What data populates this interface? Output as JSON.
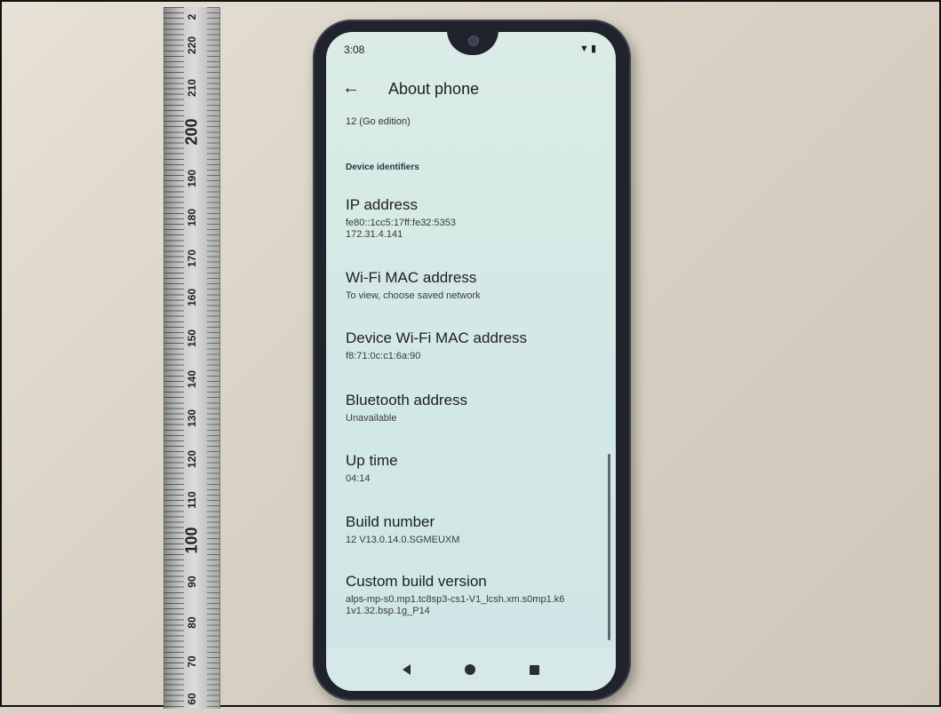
{
  "ruler": {
    "labels": [
      {
        "text": "220",
        "big": false
      },
      {
        "text": "210",
        "big": false
      },
      {
        "text": "200",
        "big": true
      },
      {
        "text": "190",
        "big": false
      },
      {
        "text": "180",
        "big": false
      },
      {
        "text": "170",
        "big": false
      },
      {
        "text": "160",
        "big": false
      },
      {
        "text": "150",
        "big": false
      },
      {
        "text": "140",
        "big": false
      },
      {
        "text": "130",
        "big": false
      },
      {
        "text": "120",
        "big": false
      },
      {
        "text": "110",
        "big": false
      },
      {
        "text": "100",
        "big": true
      },
      {
        "text": "90",
        "big": false
      },
      {
        "text": "80",
        "big": false
      },
      {
        "text": "70",
        "big": false
      },
      {
        "text": "60",
        "big": false
      }
    ],
    "top_partial": "2"
  },
  "status": {
    "time": "3:08",
    "icons": [
      "wifi-icon",
      "battery-icon"
    ]
  },
  "header": {
    "title": "About phone",
    "back_icon": "arrow-left-icon"
  },
  "android_version": {
    "value": "12 (Go edition)"
  },
  "section": {
    "title": "Device identifiers"
  },
  "items": [
    {
      "title": "IP address",
      "summary": "fe80::1cc5:17ff:fe32:5353\n172.31.4.141"
    },
    {
      "title": "Wi-Fi MAC address",
      "summary": "To view, choose saved network"
    },
    {
      "title": "Device Wi-Fi MAC address",
      "summary": "f8:71:0c:c1:6a:90"
    },
    {
      "title": "Bluetooth address",
      "summary": "Unavailable"
    },
    {
      "title": "Up time",
      "summary": "04:14"
    },
    {
      "title": "Build number",
      "summary": "12 V13.0.14.0.SGMEUXM"
    },
    {
      "title": "Custom build version",
      "summary": "alps-mp-s0.mp1.tc8sp3-cs1-V1_lcsh.xm.s0mp1.k6\n1v1.32.bsp.1g_P14"
    }
  ],
  "navbar": {
    "back": "nav-back-icon",
    "home": "nav-home-icon",
    "recents": "nav-recents-icon"
  }
}
